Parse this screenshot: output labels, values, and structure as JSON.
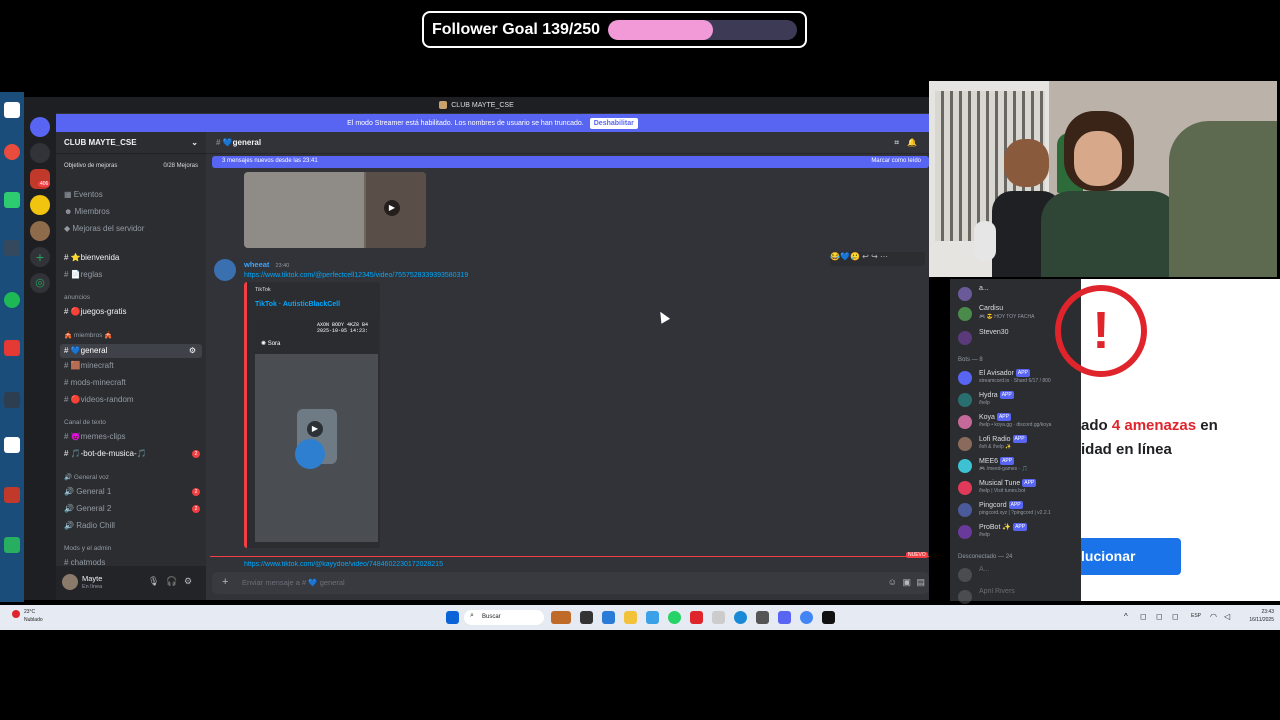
{
  "overlay": {
    "goal_label": "Follower Goal 139/250",
    "progress": 0.556,
    "fill_color": "#f29ad8"
  },
  "window": {
    "title": "CLUB MAYTE_CSE",
    "streamer_notice": "El modo Streamer está habilitado. Los nombres de usuario se han truncado.",
    "streamer_button": "Deshabilitar"
  },
  "servers": {
    "badges": [
      "8",
      "406",
      "2",
      "28"
    ]
  },
  "channels": {
    "server_name": "CLUB MAYTE_CSE",
    "boost": {
      "label": "Objetivo de mejoras",
      "count": "0/28 Mejoras"
    },
    "top_items": [
      "Eventos",
      "Miembros",
      "Mejoras del servidor"
    ],
    "items": [
      {
        "icon": "⭐",
        "label": "bienvenida"
      },
      {
        "icon": "📄",
        "label": "reglas"
      }
    ],
    "cat_anuncios": "anuncios",
    "juegos": {
      "icon": "🔴",
      "label": "juegos-gratis"
    },
    "cat_miembros": "🎪 miembros 🎪",
    "general": {
      "icon": "💙",
      "label": "general"
    },
    "mine": [
      {
        "icon": "🟫",
        "label": "minecraft"
      },
      {
        "label": "mods-minecraft"
      },
      {
        "icon": "🔴",
        "label": "videos-random"
      }
    ],
    "cat_texto": "Canal de texto",
    "texto": [
      {
        "icon": "😈",
        "label": "memes-clips"
      },
      {
        "icon": "🎵",
        "label": "-bot-de-musica-🎵",
        "badge": "2"
      }
    ],
    "cat_voz": "🔊 General voz",
    "voz": [
      {
        "label": "General 1",
        "badge": "2"
      },
      {
        "label": "General 2",
        "badge": "2"
      },
      {
        "label": "Radio Chill"
      }
    ],
    "cat_admin": "Mods y el admin",
    "chatmods": "chatmods",
    "user_name": "Mayte",
    "user_status": "En línea"
  },
  "chat": {
    "channel": "general",
    "new_messages": "3 mensajes nuevos desde las 23:41",
    "mark_read": "Marcar como leído",
    "author": "wheeat",
    "time": "23:40",
    "link": "https://www.tiktok.com/@perfectcell12345/video/7557528339393580319",
    "embed_provider": "TikTok",
    "embed_title": "TikTok · AutisticBlackCell",
    "video_caption": "AXON BODY 4KZ8 B4",
    "video_date": "2025-10-05 14:23:",
    "video_brand": "Sora",
    "next_link": "https://www.tiktok.com/@kayydoe/video/7484602230172028215",
    "nuevo": "NUEVO",
    "composer_placeholder": "Enviar mensaje a # 💙 general",
    "reactions": [
      "😂",
      "💙",
      "🥲"
    ]
  },
  "members": {
    "top": [
      {
        "name": "a...",
        "status": "",
        "color": "#a78bfa"
      },
      {
        "name": "Cardisu",
        "status": "🎮 😎 HOY TOY FACHA",
        "color": "#7dd3fc"
      },
      {
        "name": "Steven30",
        "status": "",
        "color": "#7dd3fc"
      }
    ],
    "bots_header": "Bots — 8",
    "bots": [
      {
        "name": "El Avisador",
        "status": "streamcord.io · Shard 6/17 / 800",
        "color": "#f87171"
      },
      {
        "name": "Hydra",
        "status": "/help",
        "color": "#f87171"
      },
      {
        "name": "Koya",
        "status": "/help • koya.gg · discord.gg/koya",
        "color": "#f87171"
      },
      {
        "name": "Lofi Radio",
        "status": "/lofi & /help ✨",
        "color": "#f87171"
      },
      {
        "name": "MEE6",
        "status": "🎮 /meed-games · 🎵",
        "color": "#f87171"
      },
      {
        "name": "Musical Tune",
        "status": "/help | Visit tunes.bot",
        "color": "#f87171"
      },
      {
        "name": "Pingcord",
        "status": "pingcord.xyz | ?pingcord | v2.2.1",
        "color": "#f87171"
      },
      {
        "name": "ProBot ✨",
        "status": "/help",
        "color": "#f87171"
      }
    ],
    "app_label": "APP",
    "offline_header": "Desconectado — 24",
    "offline": [
      "A...",
      "April Rivers"
    ]
  },
  "browser": {
    "line1_prefix": "ado ",
    "line1_red": "4 amenazas",
    "line1_suffix": " en",
    "line2": "idad en línea",
    "button": "lucionar"
  },
  "taskbar": {
    "weather_temp": "23°C",
    "weather_desc": "Nublado",
    "search": "Buscar",
    "lang": "ESP",
    "time": "23:43",
    "date": "16/11/2025"
  }
}
